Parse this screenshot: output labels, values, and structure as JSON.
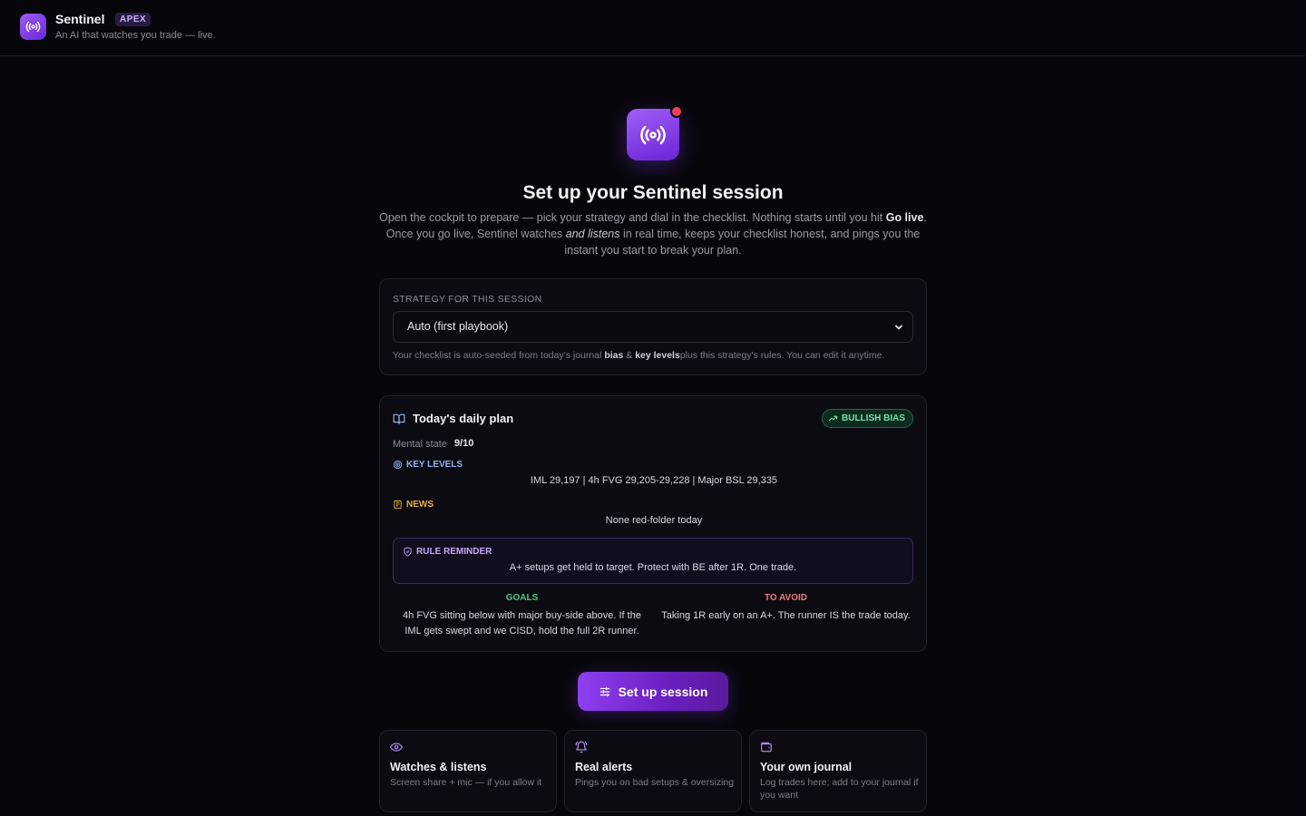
{
  "header": {
    "brand": "Sentinel",
    "badge": "APEX",
    "tagline": "An AI that watches you trade — live."
  },
  "hero": {
    "title": "Set up your Sentinel session",
    "intro_1": "Open the cockpit to prepare — pick your strategy and dial in the checklist. Nothing starts until you hit ",
    "intro_bold": "Go live",
    "intro_2": ". Once you go live, Sentinel watches ",
    "intro_italic": "and listens",
    "intro_3": " in real time, keeps your checklist honest, and pings you the instant you start to break your plan."
  },
  "strategy": {
    "label": "STRATEGY FOR THIS SESSION",
    "selected": "Auto (first playbook)",
    "help_1": "Your checklist is auto-seeded from today's journal ",
    "help_bias": "bias",
    "help_amp": " & ",
    "help_levels": "key levels",
    "help_2": "plus this strategy's rules. You can edit it anytime."
  },
  "plan": {
    "title": "Today's daily plan",
    "bias": "BULLISH BIAS",
    "mental_label": "Mental state",
    "mental_value": "9/10",
    "key_levels_label": "KEY LEVELS",
    "key_levels": "IML 29,197 | 4h FVG 29,205-29,228 | Major BSL 29,335",
    "news_label": "NEWS",
    "news": "None red-folder today",
    "rule_label": "RULE REMINDER",
    "rule": "A+ setups get held to target. Protect with BE after 1R. One trade.",
    "goals_label": "GOALS",
    "goals": "4h FVG sitting below with major buy-side above. If the IML gets swept and we CISD, hold the full 2R runner.",
    "avoid_label": "TO AVOID",
    "avoid": "Taking 1R early on an A+. The runner IS the trade today."
  },
  "cta": {
    "label": "Set up session"
  },
  "features": [
    {
      "icon": "eye-icon",
      "title": "Watches & listens",
      "desc": "Screen share + mic — if you allow it"
    },
    {
      "icon": "bell-icon",
      "title": "Real alerts",
      "desc": "Pings you on bad setups & oversizing"
    },
    {
      "icon": "wallet-icon",
      "title": "Your own journal",
      "desc": "Log trades here; add to your journal if you want"
    }
  ],
  "colors": {
    "accent": "#8f3ff0",
    "bias_green": "#6fe3a8",
    "key_levels_blue": "#8fb4f0",
    "news_yellow": "#e4b445",
    "avoid_red": "#f07878",
    "live_dot": "#f03e5a"
  }
}
